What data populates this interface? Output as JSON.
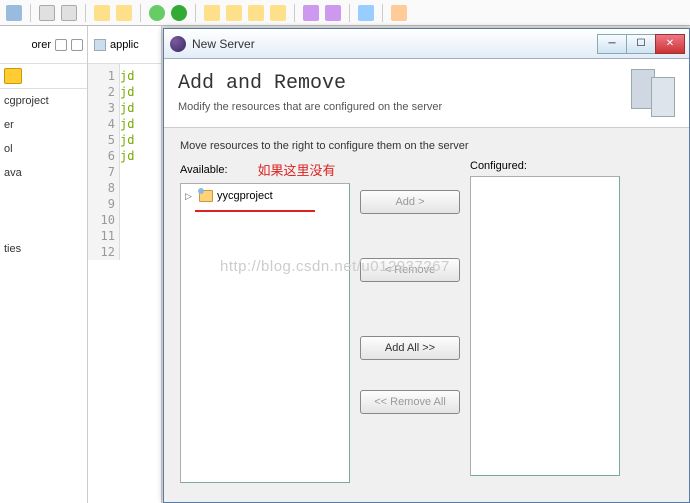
{
  "bg": {
    "explorer_label": "orer",
    "tree_items": [
      "cgproject",
      "",
      "er",
      "",
      "ol",
      "ava",
      "",
      "",
      "ties"
    ],
    "editor_tab": "applic",
    "line_numbers": [
      1,
      2,
      3,
      4,
      5,
      6,
      7,
      8,
      9,
      10,
      11,
      12
    ],
    "code_fragment": "jd"
  },
  "dialog": {
    "title": "New Server",
    "heading": "Add and Remove",
    "subheading": "Modify the resources that are configured on the server",
    "instruction": "Move resources to the right to configure them on the server",
    "available_label": "Available:",
    "configured_label": "Configured:",
    "annotation": "如果这里没有",
    "available_items": [
      "yycgproject"
    ],
    "buttons": {
      "add": "Add >",
      "remove": "< Remove",
      "add_all": "Add All >>",
      "remove_all": "<< Remove All"
    },
    "window_controls": {
      "min": "─",
      "max": "☐",
      "close": "✕"
    }
  },
  "watermark": "http://blog.csdn.net/u012937267"
}
